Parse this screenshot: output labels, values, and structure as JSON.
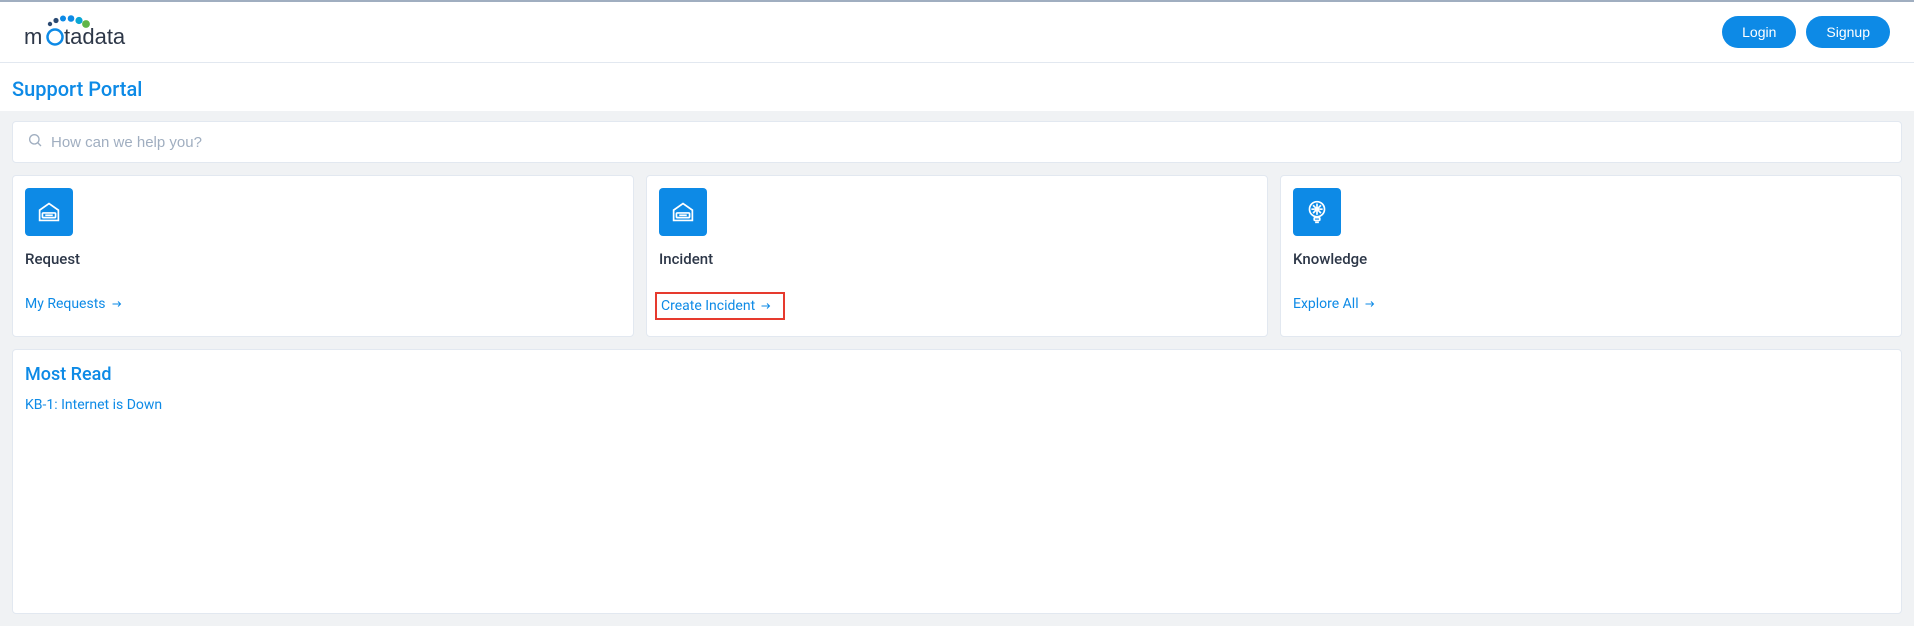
{
  "header": {
    "login_label": "Login",
    "signup_label": "Signup"
  },
  "page_title": "Support Portal",
  "search": {
    "placeholder": "How can we help you?"
  },
  "cards": {
    "request": {
      "title": "Request",
      "link_label": "My Requests"
    },
    "incident": {
      "title": "Incident",
      "link_label": "Create Incident"
    },
    "knowledge": {
      "title": "Knowledge",
      "link_label": "Explore All"
    }
  },
  "most_read": {
    "title": "Most Read",
    "items": {
      "0": {
        "label": "KB-1: Internet is Down"
      }
    }
  }
}
